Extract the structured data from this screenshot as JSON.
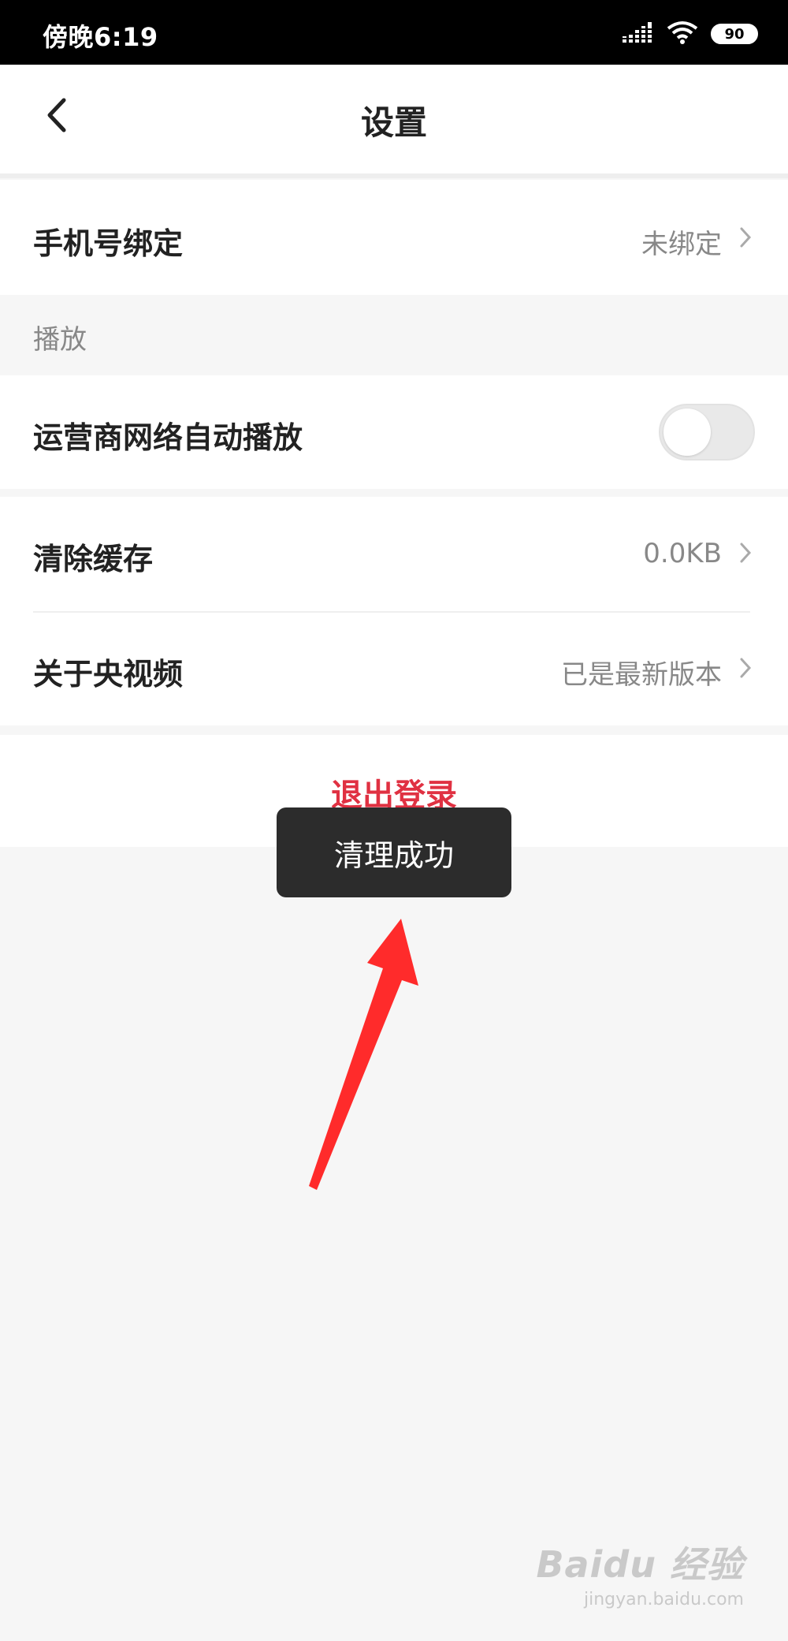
{
  "status_bar": {
    "time": "傍晚6:19",
    "battery": "90",
    "icons": [
      "signal-icon",
      "wifi-icon",
      "battery-icon"
    ]
  },
  "header": {
    "title": "设置",
    "back_icon": "chevron-left-icon"
  },
  "settings": {
    "phone_binding": {
      "label": "手机号绑定",
      "value": "未绑定"
    },
    "section_playback": "播放",
    "carrier_autoplay": {
      "label": "运营商网络自动播放",
      "enabled": false
    },
    "clear_cache": {
      "label": "清除缓存",
      "value": "0.0KB"
    },
    "about": {
      "label": "关于央视频",
      "value": "已是最新版本"
    }
  },
  "logout": {
    "label": "退出登录"
  },
  "toast": {
    "message": "清理成功"
  },
  "annotation": {
    "type": "red-arrow",
    "color": "#ff2b2b"
  },
  "watermark": {
    "brand": "Baidu 经验",
    "url": "jingyan.baidu.com"
  },
  "colors": {
    "accent_red": "#e03142",
    "background": "#f6f6f6",
    "toast_bg": "#2c2c2c"
  }
}
